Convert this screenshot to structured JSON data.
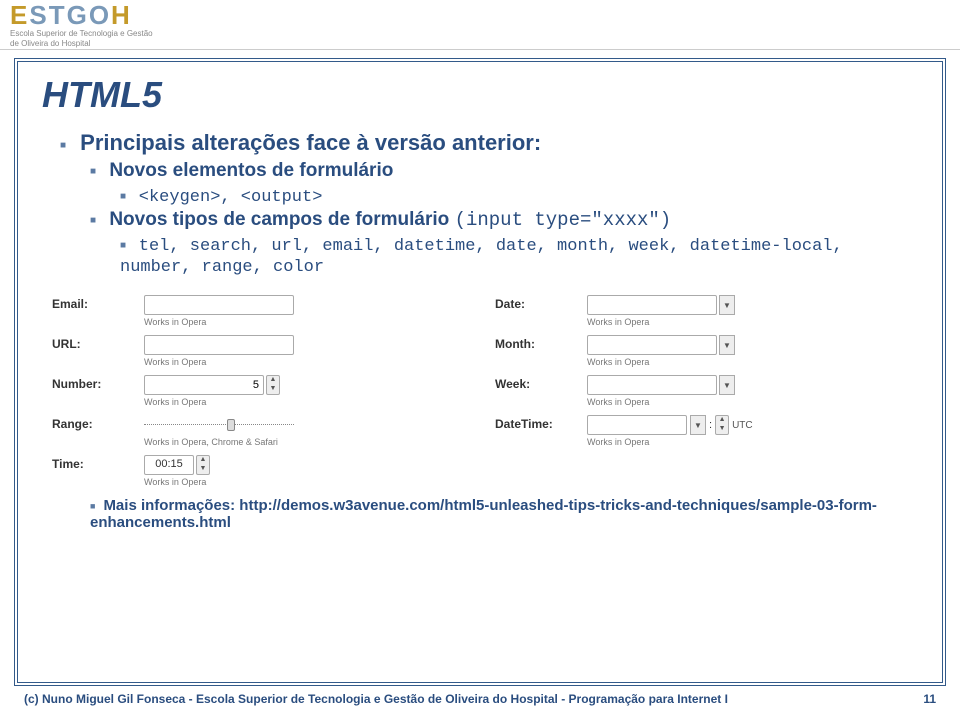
{
  "logo": {
    "sub1": "Escola Superior de Tecnologia e Gestão",
    "sub2": "de Oliveira do Hospital"
  },
  "title": "HTML5",
  "bullet1": "Principais alterações face à versão anterior:",
  "bullet2": "Novos elementos de formulário",
  "bullet2_items": "<keygen>, <output>",
  "bullet3": "Novos tipos de campos de formulário ",
  "bullet3_code": "(input type=\"xxxx\")",
  "bullet3_items": "tel, search, url, email, datetime, date, month, week, datetime-local, number, range, color",
  "form": {
    "email_label": "Email:",
    "url_label": "URL:",
    "number_label": "Number:",
    "number_value": "5",
    "range_label": "Range:",
    "time_label": "Time:",
    "time_value": "00:15",
    "date_label": "Date:",
    "month_label": "Month:",
    "week_label": "Week:",
    "datetime_label": "DateTime:",
    "utc": "UTC",
    "hint_opera": "Works in Opera",
    "hint_range": "Works in Opera, Chrome & Safari"
  },
  "moreinfo": "Mais informações: http://demos.w3avenue.com/html5-unleashed-tips-tricks-and-techniques/sample-03-form-enhancements.html",
  "footer_left": "(c) Nuno Miguel Gil Fonseca  -  Escola Superior de Tecnologia e Gestão de Oliveira do Hospital  -  Programação para Internet I",
  "footer_right": "11"
}
